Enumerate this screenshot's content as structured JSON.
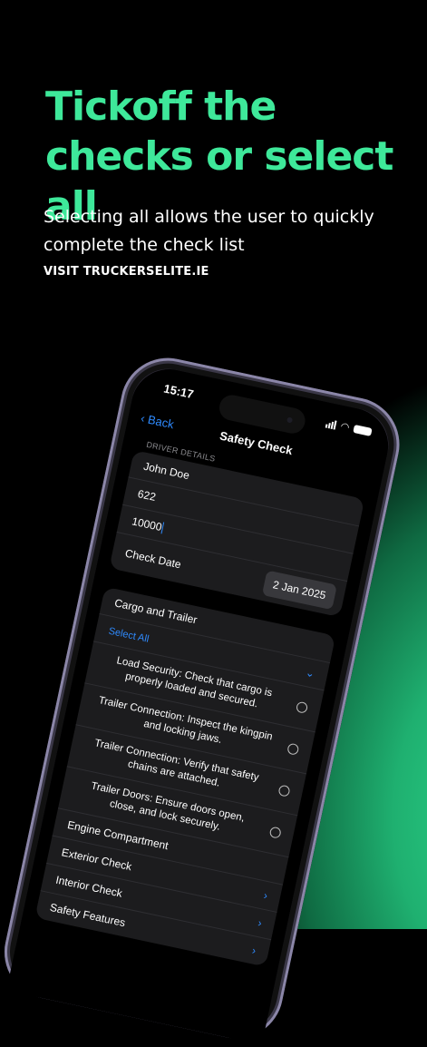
{
  "headline": "Tickoff the checks or select all",
  "subtext": "Selecting all allows the user to quickly complete the check list",
  "visit": "VISIT TRUCKERSELITE.IE",
  "colors": {
    "accent_green": "#3ee89a",
    "link_blue": "#2f8bff",
    "background": "#000000"
  },
  "phone": {
    "time": "15:17",
    "nav": {
      "back_label": "Back",
      "title": "Safety Check"
    },
    "driver_section_label": "DRIVER DETAILS",
    "driver_fields": [
      "John Doe",
      "622",
      "10000"
    ],
    "check_date_label": "Check Date",
    "check_date_value": "2 Jan 2025",
    "cargo": {
      "title": "Cargo and Trailer",
      "select_all": "Select All",
      "checks": [
        "Load Security: Check that cargo is properly loaded and secured.",
        "Trailer Connection: Inspect the kingpin and locking jaws.",
        "Trailer Connection: Verify that safety chains are attached.",
        "Trailer Doors: Ensure doors open, close, and lock securely."
      ]
    },
    "categories": [
      "Engine Compartment",
      "Exterior Check",
      "Interior Check",
      "Safety Features"
    ]
  }
}
